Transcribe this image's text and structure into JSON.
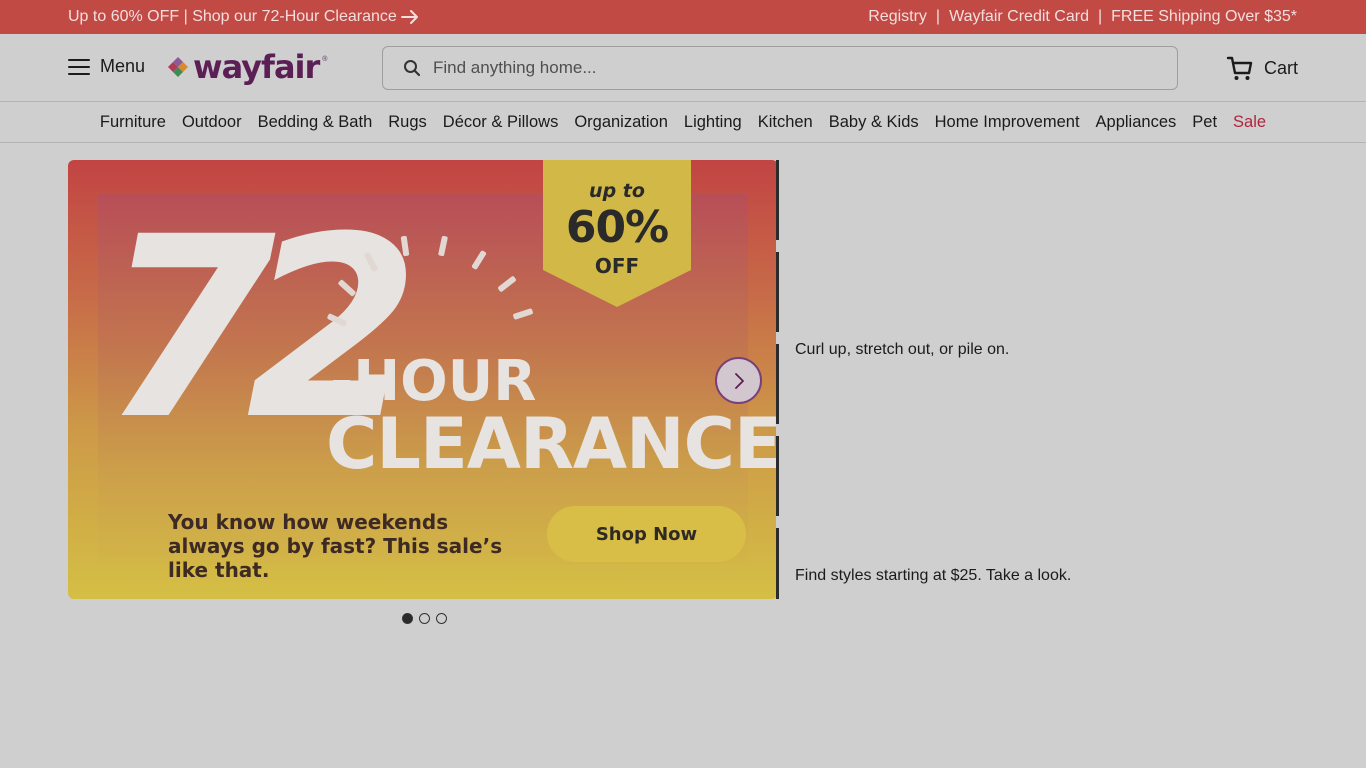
{
  "promo": {
    "left_text": "Up to 60% OFF | Shop our 72-Hour Clearance",
    "right_links": [
      "Registry",
      "Wayfair Credit Card",
      "FREE Shipping Over $35*"
    ],
    "separator": "|"
  },
  "header": {
    "menu_label": "Menu",
    "logo_text": "wayfair",
    "logo_reg": "®",
    "search_placeholder": "Find anything home...",
    "cart_label": "Cart"
  },
  "categories": [
    "Furniture",
    "Outdoor",
    "Bedding & Bath",
    "Rugs",
    "Décor & Pillows",
    "Organization",
    "Lighting",
    "Kitchen",
    "Baby & Kids",
    "Home Improvement",
    "Appliances",
    "Pet",
    "Sale"
  ],
  "hero": {
    "big_number": "72",
    "hour_text": "-HOUR",
    "clearance_text": "CLEARANCE",
    "badge_up_to": "up to",
    "badge_pct": "60%",
    "badge_off": "OFF",
    "copy": "You know how weekends always go by fast? This sale’s like that.",
    "cta": "Shop Now",
    "slide_count": 3,
    "active_slide": 1
  },
  "side_panels": [
    "Curl up, stretch out, or pile on.",
    "Find styles starting at $25. Take a look."
  ],
  "colors": {
    "promo_bg": "#c24a45",
    "brand_purple": "#5b1f56",
    "sale_red": "#b0253f",
    "cta_yellow": "#d8be47"
  }
}
